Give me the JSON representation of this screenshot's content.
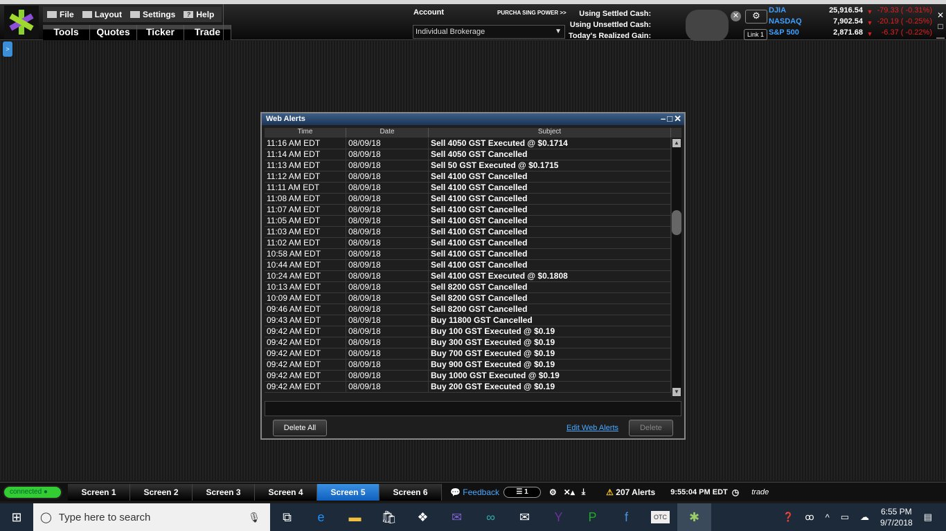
{
  "header": {
    "menu": [
      "File",
      "Layout",
      "Settings",
      "Help"
    ],
    "tabs": [
      "Tools",
      "Quotes",
      "Ticker",
      "Trade"
    ],
    "account_label": "Account",
    "account_value": "Individual Brokerage",
    "purchasing_power": "PURCHA SING POWER >>",
    "cash_labels": [
      "Using Settled Cash:",
      "Using Unsettled Cash:",
      "Today's Realized Gain:"
    ],
    "link": "Link 1"
  },
  "indices": [
    {
      "name": "DJIA",
      "value": "25,916.54",
      "change": "-79.33 ( -0.31%)"
    },
    {
      "name": "NASDAQ",
      "value": "7,902.54",
      "change": "-20.19 ( -0.25%)"
    },
    {
      "name": "S&P 500",
      "value": "2,871.68",
      "change": "-6.37 ( -0.22%)"
    }
  ],
  "window": {
    "title": "Web Alerts",
    "columns": [
      "Time",
      "Date",
      "Subject"
    ],
    "rows": [
      [
        "11:16 AM EDT",
        "08/09/18",
        "Sell 4050 GST Executed @ $0.1714"
      ],
      [
        "11:14 AM EDT",
        "08/09/18",
        "Sell 4050 GST Cancelled"
      ],
      [
        "11:13 AM EDT",
        "08/09/18",
        "Sell 50 GST Executed @ $0.1715"
      ],
      [
        "11:12 AM EDT",
        "08/09/18",
        "Sell 4100 GST Cancelled"
      ],
      [
        "11:11 AM EDT",
        "08/09/18",
        "Sell 4100 GST Cancelled"
      ],
      [
        "11:08 AM EDT",
        "08/09/18",
        "Sell 4100 GST Cancelled"
      ],
      [
        "11:07 AM EDT",
        "08/09/18",
        "Sell 4100 GST Cancelled"
      ],
      [
        "11:05 AM EDT",
        "08/09/18",
        "Sell 4100 GST Cancelled"
      ],
      [
        "11:03 AM EDT",
        "08/09/18",
        "Sell 4100 GST Cancelled"
      ],
      [
        "11:02 AM EDT",
        "08/09/18",
        "Sell 4100 GST Cancelled"
      ],
      [
        "10:58 AM EDT",
        "08/09/18",
        "Sell 4100 GST Cancelled"
      ],
      [
        "10:44 AM EDT",
        "08/09/18",
        "Sell 4100 GST Cancelled"
      ],
      [
        "10:24 AM EDT",
        "08/09/18",
        "Sell 4100 GST Executed @ $0.1808"
      ],
      [
        "10:13 AM EDT",
        "08/09/18",
        "Sell 8200 GST Cancelled"
      ],
      [
        "10:09 AM EDT",
        "08/09/18",
        "Sell 8200 GST Cancelled"
      ],
      [
        "09:46 AM EDT",
        "08/09/18",
        "Sell 8200 GST Cancelled"
      ],
      [
        "09:43 AM EDT",
        "08/09/18",
        "Buy 11800 GST Cancelled"
      ],
      [
        "09:42 AM EDT",
        "08/09/18",
        "Buy 100 GST Executed @ $0.19"
      ],
      [
        "09:42 AM EDT",
        "08/09/18",
        "Buy 300 GST Executed @ $0.19"
      ],
      [
        "09:42 AM EDT",
        "08/09/18",
        "Buy 700 GST Executed @ $0.19"
      ],
      [
        "09:42 AM EDT",
        "08/09/18",
        "Buy 900 GST Executed @ $0.19"
      ],
      [
        "09:42 AM EDT",
        "08/09/18",
        "Buy 1000 GST Executed @ $0.19"
      ],
      [
        "09:42 AM EDT",
        "08/09/18",
        "Buy 200 GST Executed @ $0.19"
      ]
    ],
    "delete_all": "Delete All",
    "edit_link": "Edit Web Alerts",
    "delete": "Delete"
  },
  "status": {
    "connected": "connected",
    "screens": [
      "Screen 1",
      "Screen 2",
      "Screen 3",
      "Screen 4",
      "Screen 5",
      "Screen 6"
    ],
    "active_screen": "Screen 5",
    "feedback": "Feedback",
    "pill_count": "1",
    "alerts": "207 Alerts",
    "time": "9:55:04 PM EDT",
    "trade": "trade"
  },
  "taskbar": {
    "search_placeholder": "Type here to search",
    "otc": "OTC",
    "time": "6:55 PM",
    "date": "9/7/2018"
  },
  "colors": {
    "accent": "#3a90e0",
    "negative": "#e02020",
    "link": "#4aa8ff",
    "connected": "#33cc33"
  }
}
